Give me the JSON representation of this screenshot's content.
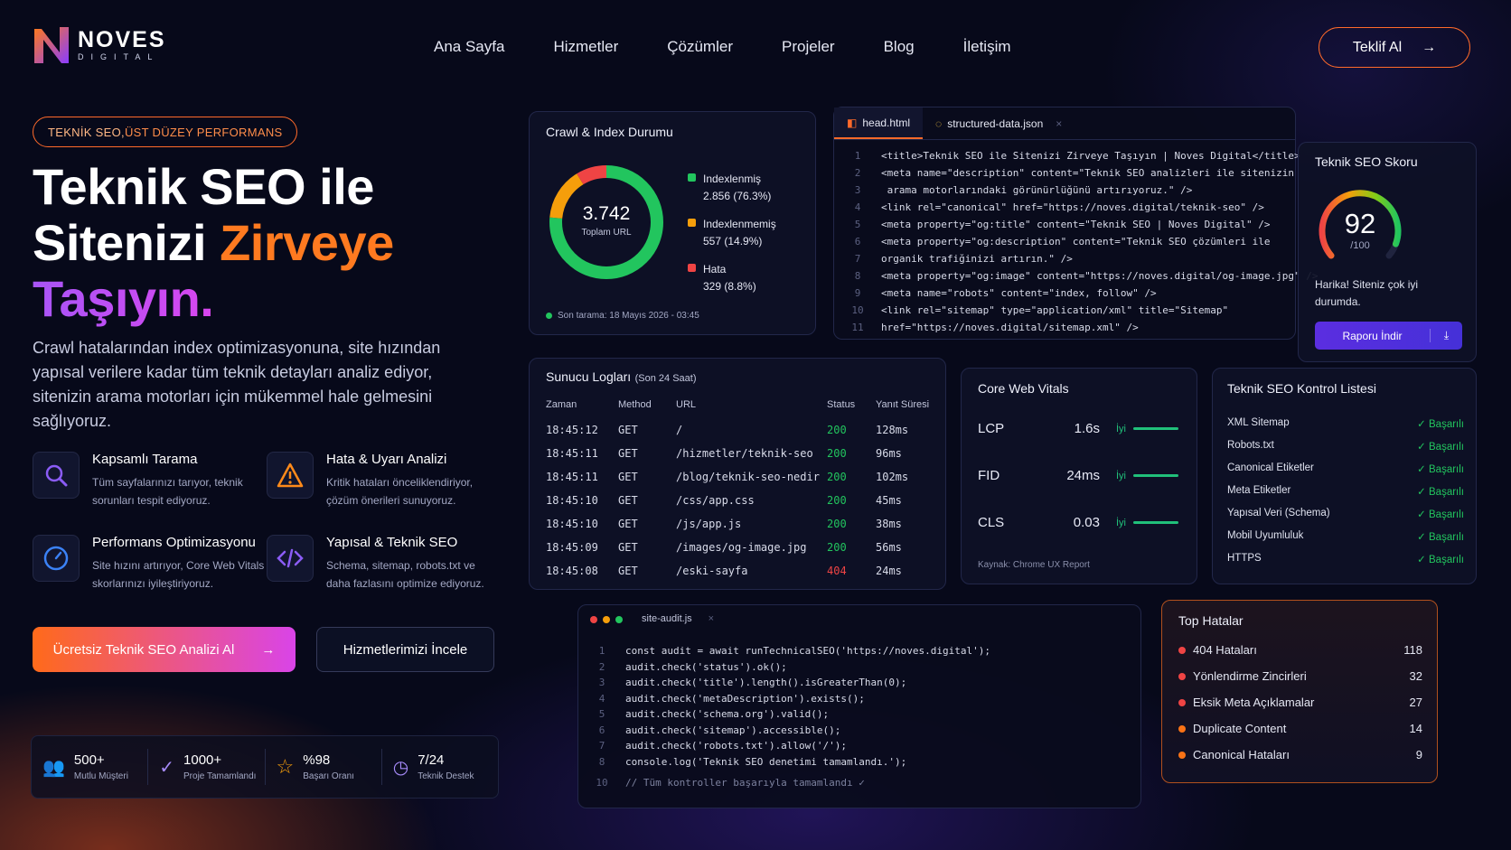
{
  "brand": {
    "name": "NOVES",
    "sub": "DIGITAL"
  },
  "nav": [
    "Ana Sayfa",
    "Hizmetler",
    "Çözümler",
    "Projeler",
    "Blog",
    "İletişim"
  ],
  "cta_top": "Teklif Al",
  "hero": {
    "pill_a": "TEKNİK SEO,",
    "pill_b": " ÜST DÜZEY PERFORMANS",
    "line1": "Teknik SEO ile",
    "line2a": "Sitenizi ",
    "line2b": "Zirveye",
    "line3": "Taşıyın.",
    "lead": "Crawl hatalarından index optimizasyonuna, site hızından yapısal verilere kadar tüm teknik detayları analiz ediyor, sitenizin arama motorları için mükemmel hale gelmesini sağlıyoruz."
  },
  "features": [
    {
      "title": "Kapsamlı Tarama",
      "desc": "Tüm sayfalarınızı tarıyor, teknik sorunları tespit ediyoruz."
    },
    {
      "title": "Hata & Uyarı Analizi",
      "desc": "Kritik hataları önceliklendiriyor, çözüm önerileri sunuyoruz."
    },
    {
      "title": "Performans Optimizasyonu",
      "desc": "Site hızını artırıyor, Core Web Vitals skorlarınızı iyileştiriyoruz."
    },
    {
      "title": "Yapısal & Teknik SEO",
      "desc": "Schema, sitemap, robots.txt ve daha fazlasını optimize ediyoruz."
    }
  ],
  "buttons": {
    "primary": "Ücretsiz Teknik SEO Analizi Al",
    "secondary": "Hizmetlerimizi İncele"
  },
  "stats": [
    {
      "value": "500+",
      "label": "Mutlu Müşteri"
    },
    {
      "value": "1000+",
      "label": "Proje Tamamlandı"
    },
    {
      "value": "%98",
      "label": "Başarı Oranı"
    },
    {
      "value": "7/24",
      "label": "Teknik Destek"
    }
  ],
  "crawl": {
    "title": "Crawl & Index Durumu",
    "total": "3.742",
    "total_label": "Toplam URL",
    "items": [
      {
        "label": "Indexlenmiş",
        "value": "2.856 (76.3%)",
        "color": "#22c55e",
        "share": 76.3
      },
      {
        "label": "Indexlenmemiş",
        "value": "557 (14.9%)",
        "color": "#f59e0b",
        "share": 14.9
      },
      {
        "label": "Hata",
        "value": "329 (8.8%)",
        "color": "#ef4444",
        "share": 8.8
      }
    ],
    "last_scan": "Son tarama: 18 Mayıs 2026 - 03:45"
  },
  "editor": {
    "tabs": [
      "head.html",
      "structured-data.json"
    ],
    "lines": [
      [
        "<title>",
        "Teknik SEO ile Sitenizi Zirveye Taşıyın | Noves Digital",
        "</title>"
      ],
      [
        "<meta name=\"description\" content=\"Teknik SEO analizleri ile sitenizin"
      ],
      [
        " arama motorlarındaki görünürlüğünü artırıyoruz.\" />"
      ],
      [
        "<link rel=\"canonical\" href=\"https://noves.digital/teknik-seo\" />"
      ],
      [
        "<meta property=\"og:title\" content=\"Teknik SEO | Noves Digital\" />"
      ],
      [
        "<meta property=\"og:description\" content=\"Teknik SEO çözümleri ile"
      ],
      [
        "organik trafiğinizi artırın.\" />"
      ],
      [
        "<meta property=\"og:image\" content=\"https://noves.digital/og-image.jpg\" />"
      ],
      [
        "<meta name=\"robots\" content=\"index, follow\" />"
      ],
      [
        "<link rel=\"sitemap\" type=\"application/xml\" title=\"Sitemap\""
      ],
      [
        "href=\"https://noves.digital/sitemap.xml\" />"
      ]
    ]
  },
  "score": {
    "title": "Teknik SEO Skoru",
    "value": 92,
    "max": "/100",
    "msg": "Harika! Siteniz çok iyi durumda.",
    "button": "Raporu İndir"
  },
  "logs": {
    "title": "Sunucu Logları",
    "subtitle": "(Son 24 Saat)",
    "headers": [
      "Zaman",
      "Method",
      "URL",
      "Status",
      "Yanıt Süresi"
    ],
    "rows": [
      [
        "18:45:12",
        "GET",
        "/",
        "200",
        "128ms"
      ],
      [
        "18:45:11",
        "GET",
        "/hizmetler/teknik-seo",
        "200",
        "96ms"
      ],
      [
        "18:45:11",
        "GET",
        "/blog/teknik-seo-nedir",
        "200",
        "102ms"
      ],
      [
        "18:45:10",
        "GET",
        "/css/app.css",
        "200",
        "45ms"
      ],
      [
        "18:45:10",
        "GET",
        "/js/app.js",
        "200",
        "38ms"
      ],
      [
        "18:45:09",
        "GET",
        "/images/og-image.jpg",
        "200",
        "56ms"
      ],
      [
        "18:45:08",
        "GET",
        "/eski-sayfa",
        "404",
        "24ms"
      ]
    ]
  },
  "cwv": {
    "title": "Core Web Vitals",
    "rows": [
      {
        "name": "LCP",
        "value": "1.6s",
        "status": "İyi"
      },
      {
        "name": "FID",
        "value": "24ms",
        "status": "İyi"
      },
      {
        "name": "CLS",
        "value": "0.03",
        "status": "İyi"
      }
    ],
    "source": "Kaynak: Chrome UX Report"
  },
  "checklist": {
    "title": "Teknik SEO Kontrol Listesi",
    "items": [
      "XML Sitemap",
      "Robots.txt",
      "Canonical Etiketler",
      "Meta Etiketler",
      "Yapısal Veri (Schema)",
      "Mobil Uyumluluk",
      "HTTPS"
    ],
    "status": "Başarılı"
  },
  "audit": {
    "tab": "site-audit.js",
    "lines": [
      "const audit = await runTechnicalSEO('https://noves.digital');",
      "audit.check('status').ok();",
      "audit.check('title').length().isGreaterThan(0);",
      "audit.check('metaDescription').exists();",
      "audit.check('schema.org').valid();",
      "audit.check('sitemap').accessible();",
      "audit.check('robots.txt').allow('/');",
      "console.log('Teknik SEO denetimi tamamlandı.');"
    ],
    "last": "// Tüm kontroller başarıyla tamamlandı ✓"
  },
  "top_errors": {
    "title": "Top Hatalar",
    "items": [
      {
        "label": "404 Hataları",
        "count": "118",
        "color": "#ef4444"
      },
      {
        "label": "Yönlendirme Zincirleri",
        "count": "32",
        "color": "#ef4444"
      },
      {
        "label": "Eksik Meta Açıklamalar",
        "count": "27",
        "color": "#ef4444"
      },
      {
        "label": "Duplicate Content",
        "count": "14",
        "color": "#f97316"
      },
      {
        "label": "Canonical Hataları",
        "count": "9",
        "color": "#f97316"
      }
    ]
  }
}
